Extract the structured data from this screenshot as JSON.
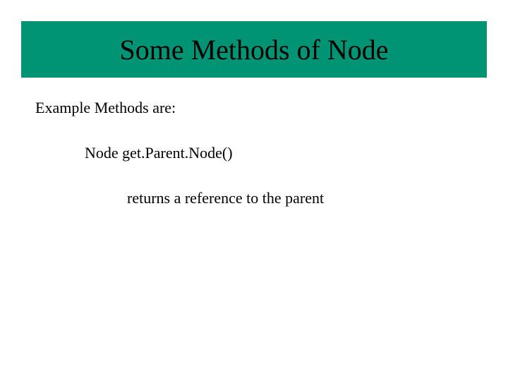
{
  "title": "Some Methods of Node",
  "intro": "Example Methods are:",
  "method_name": "Node get.Parent.Node()",
  "method_desc": "returns a reference to the parent"
}
